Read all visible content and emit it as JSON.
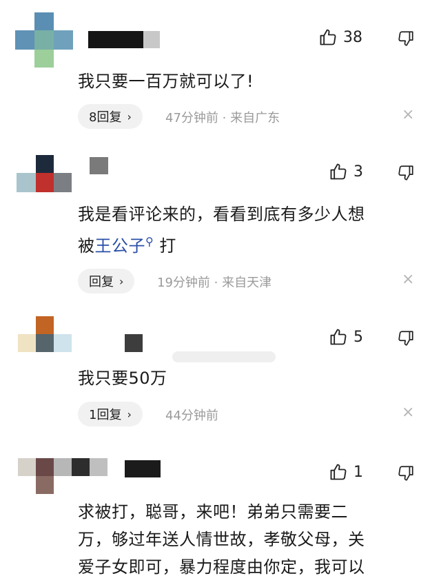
{
  "comments": [
    {
      "likes": "38",
      "text_lines": [
        "我只要一百万就可以了!"
      ],
      "reply_label": "8回复",
      "meta": "47分钟前 · 来自广东"
    },
    {
      "likes": "3",
      "text_lines": [
        "我是看评论来的，看看到底有多少人想"
      ],
      "text_prefix": "被",
      "link_text": "王公子",
      "text_suffix": " 打",
      "reply_label": "回复",
      "meta": "19分钟前 · 来自天津"
    },
    {
      "likes": "5",
      "text_lines": [
        "我只要50万"
      ],
      "reply_label": "1回复",
      "meta": "44分钟前"
    },
    {
      "likes": "1",
      "text_lines": [
        "求被打，聪哥，来吧！弟弟只需要二",
        "万，够过年送人情世故，孝敬父母，关",
        "爱子女即可，暴力程度由你定，我可以"
      ]
    }
  ],
  "icons": {
    "like": "thumbs-up-icon",
    "dislike": "thumbs-down-icon",
    "close": "close-icon",
    "chevron": "chevron-right-icon",
    "search": "search-icon"
  },
  "colors": {
    "link": "#2a4fa8",
    "meta": "#9a9a9a",
    "pill_bg": "#f1f1f1"
  },
  "glyphs": {
    "chevron": "›",
    "close": "×",
    "search": "⚲"
  }
}
